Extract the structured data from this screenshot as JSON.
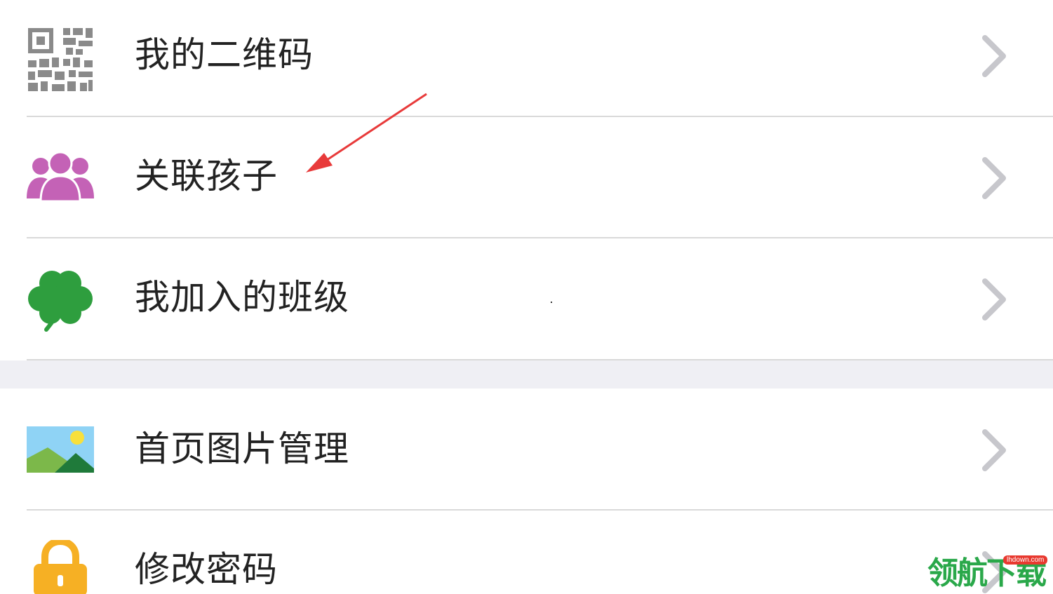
{
  "menu_group_1": {
    "items": [
      {
        "label": "我的二维码",
        "icon": "qr-code-icon"
      },
      {
        "label": "关联孩子",
        "icon": "users-icon"
      },
      {
        "label": "我加入的班级",
        "icon": "clover-icon"
      }
    ]
  },
  "menu_group_2": {
    "items": [
      {
        "label": "首页图片管理",
        "icon": "image-icon"
      },
      {
        "label": "修改密码",
        "icon": "lock-icon"
      }
    ]
  },
  "watermark": {
    "text": "领航下载",
    "tag": "lhdown.com"
  },
  "colors": {
    "users_icon": "#c462b6",
    "clover_icon": "#2e9e3e",
    "lock_icon": "#f6b024",
    "annotation_arrow": "#e83a3a",
    "watermark_green": "#2aa84a",
    "watermark_red": "#e8392f"
  }
}
